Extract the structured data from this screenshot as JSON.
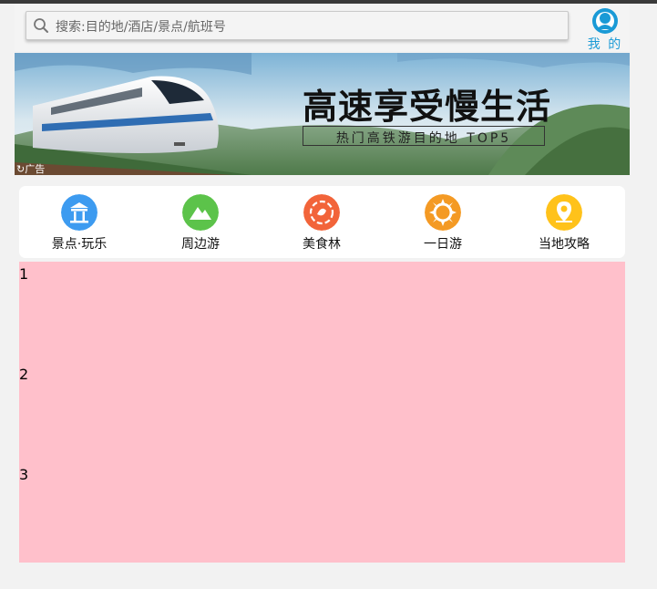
{
  "search": {
    "placeholder": "搜索:目的地/酒店/景点/航班号",
    "icon": "search-icon"
  },
  "me": {
    "label": "我 的",
    "icon": "user-icon",
    "color": "#1a9ad6"
  },
  "banner": {
    "title": "高速享受慢生活",
    "subtitle": "热门高铁游目的地 TOP5",
    "ad_label": "广告",
    "image": "high-speed-train-landscape"
  },
  "nav": {
    "items": [
      {
        "label": "景点·玩乐",
        "icon": "pavilion-icon",
        "color": "#3d9bf0"
      },
      {
        "label": "周边游",
        "icon": "mountain-icon",
        "color": "#5cc34a"
      },
      {
        "label": "美食林",
        "icon": "food-icon",
        "color": "#f2643a"
      },
      {
        "label": "一日游",
        "icon": "sun-icon",
        "color": "#f49a24"
      },
      {
        "label": "当地攻略",
        "icon": "map-pin-icon",
        "color": "#ffc21a"
      }
    ]
  },
  "content": {
    "background": "#ffc0cb",
    "rows": [
      "1",
      "2",
      "3"
    ]
  }
}
